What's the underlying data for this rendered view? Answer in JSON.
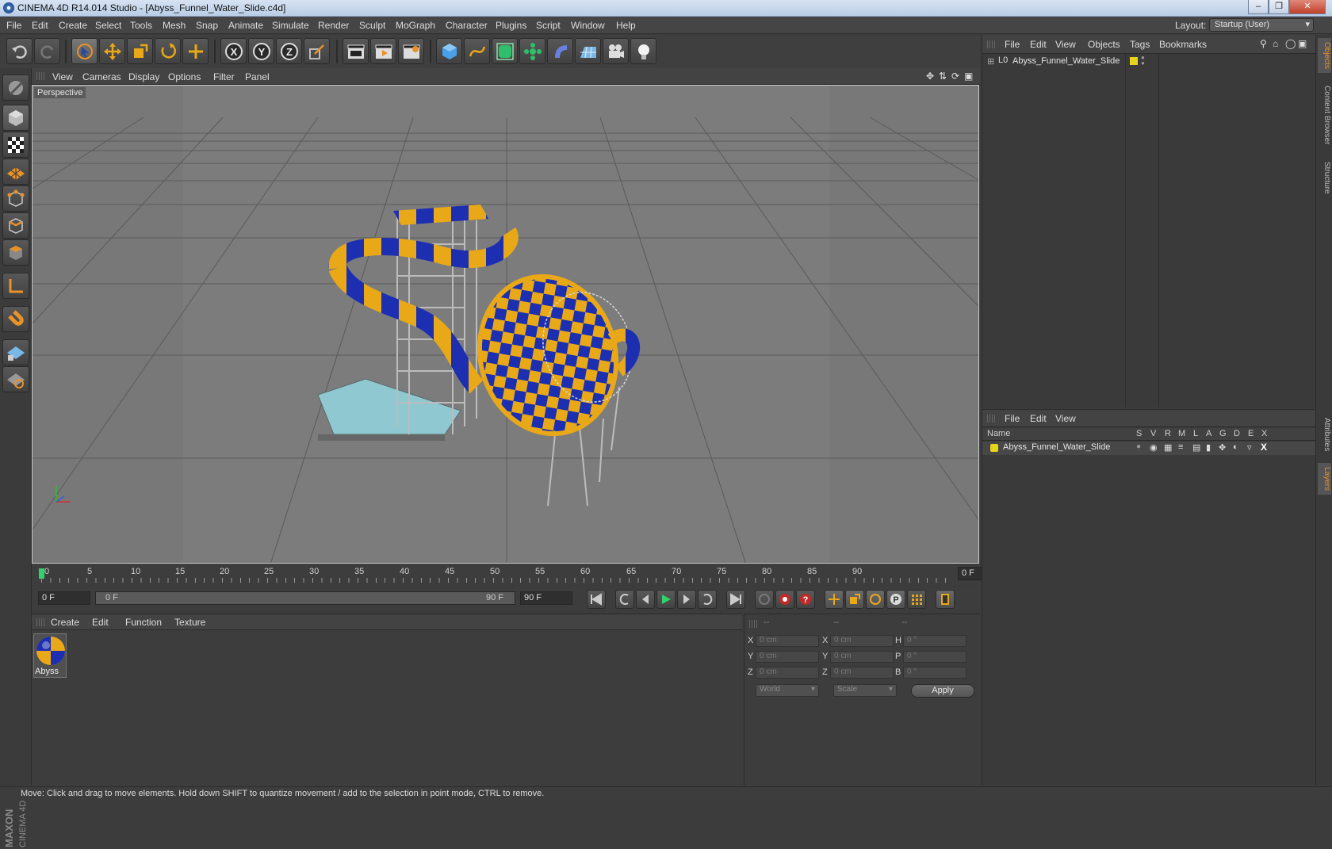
{
  "window": {
    "title": "CINEMA 4D R14.014 Studio - [Abyss_Funnel_Water_Slide.c4d]",
    "buttons": [
      "–",
      "❐",
      "✕"
    ]
  },
  "menubar": {
    "items": [
      "File",
      "Edit",
      "Create",
      "Select",
      "Tools",
      "Mesh",
      "Snap",
      "Animate",
      "Simulate",
      "Render",
      "Sculpt",
      "MoGraph",
      "Character",
      "Plugins",
      "Script",
      "Window",
      "Help"
    ],
    "layout_label": "Layout:",
    "layout_value": "Startup (User)"
  },
  "viewport": {
    "menu": [
      "View",
      "Cameras",
      "Display",
      "Options",
      "Filter",
      "Panel"
    ],
    "label": "Perspective"
  },
  "timeline": {
    "ticks": [
      "0",
      "5",
      "10",
      "15",
      "20",
      "25",
      "30",
      "35",
      "40",
      "45",
      "50",
      "55",
      "60",
      "65",
      "70",
      "75",
      "80",
      "85",
      "90"
    ],
    "current": "0 F"
  },
  "transport": {
    "start": "0 F",
    "range_start": "0 F",
    "range_end": "90 F",
    "end": "90 F"
  },
  "material_manager": {
    "menu": [
      "Create",
      "Edit",
      "Function",
      "Texture"
    ],
    "material_name": "Abyss"
  },
  "coordinates": {
    "header": [
      "--",
      "--",
      "--"
    ],
    "rows": [
      [
        "X",
        "0 cm",
        "X",
        "0 cm",
        "H",
        "0 °"
      ],
      [
        "Y",
        "0 cm",
        "Y",
        "0 cm",
        "P",
        "0 °"
      ],
      [
        "Z",
        "0 cm",
        "Z",
        "0 cm",
        "B",
        "0 °"
      ]
    ],
    "mode": "World",
    "type": "Scale",
    "apply": "Apply"
  },
  "object_manager": {
    "menu": [
      "File",
      "Edit",
      "View",
      "Objects",
      "Tags",
      "Bookmarks"
    ],
    "object": "Abyss_Funnel_Water_Slide"
  },
  "layer_manager": {
    "menu": [
      "File",
      "Edit",
      "View"
    ],
    "columns": [
      "Name",
      "S",
      "V",
      "R",
      "M",
      "L",
      "A",
      "G",
      "D",
      "E",
      "X"
    ],
    "layer": "Abyss_Funnel_Water_Slide"
  },
  "side_tabs": [
    "Objects",
    "Content Browser",
    "Structure",
    "Attributes",
    "Layers"
  ],
  "status": "Move: Click and drag to move elements. Hold down SHIFT to quantize movement / add to the selection in point mode, CTRL to remove.",
  "branding": {
    "maxon": "MAXON",
    "c4d": "CINEMA 4D"
  },
  "colors": {
    "yellow": "#e8a817",
    "blue": "#1b2fb0",
    "accent_orange": "#e8922a"
  }
}
